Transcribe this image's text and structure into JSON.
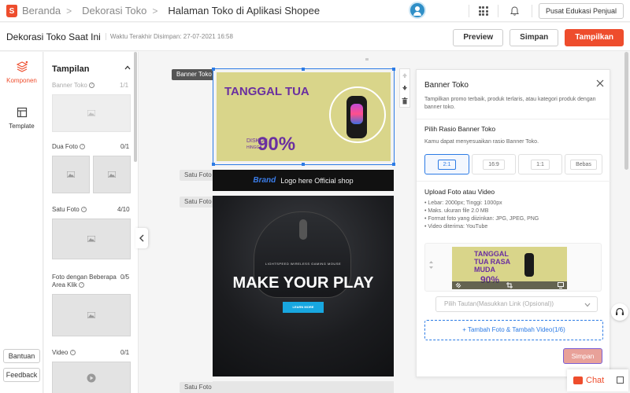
{
  "nav": {
    "breadcrumbs": [
      "Beranda",
      "Dekorasi Toko",
      "Halaman Toko di Aplikasi Shopee"
    ],
    "edu_button": "Pusat Edukasi Penjual"
  },
  "header": {
    "title": "Dekorasi Toko Saat Ini",
    "saved": "Waktu Terakhir Disimpan: 27-07-2021 16:58",
    "preview": "Preview",
    "save": "Simpan",
    "publish": "Tampilkan"
  },
  "leftbar": {
    "komponen": "Komponen",
    "template": "Template",
    "bantuan": "Bantuan",
    "feedback": "Feedback"
  },
  "panel": {
    "title": "Tampilan",
    "components": [
      {
        "label": "Banner Toko",
        "count": "1/1"
      },
      {
        "label": "Dua Foto",
        "count": "0/1"
      },
      {
        "label": "Satu Foto",
        "count": "4/10"
      },
      {
        "label": "Foto dengan Beberapa Area Klik",
        "count": "0/5"
      },
      {
        "label": "Video",
        "count": "0/1"
      }
    ]
  },
  "canvas": {
    "banner_label": "Banner Toko",
    "satu_foto": "Satu Foto",
    "banner_headline": "TANGGAL TUA",
    "banner_diskon": "DISKON",
    "banner_hingga": "HINGGA",
    "banner_pct": "90%",
    "brand": "Brand",
    "brand_text": "Logo here Official shop",
    "mouse_small": "LIGHTSPEED WIRELESS GAMING MOUSE",
    "mouse_big": "MAKE YOUR PLAY",
    "learn_more": "LEARN MORE"
  },
  "settings": {
    "title": "Banner Toko",
    "desc": "Tampilkan promo terbaik, produk terlaris, atau kategori produk dengan banner toko.",
    "ratio_title": "Pilih Rasio Banner Toko",
    "ratio_desc": "Kamu dapat menyesuaikan rasio Banner Toko.",
    "ratios": [
      "2:1",
      "16:9",
      "1:1",
      "Bebas"
    ],
    "upload_title": "Upload Foto atau Video",
    "bullets": [
      "Lebar: 2000px; Tinggi: 1000px",
      "Maks. ukuran file 2.0 MB",
      "Format foto yang diizinkan: JPG, JPEG, PNG",
      "Video diterima: YouTube"
    ],
    "thumb_headline": "TANGGAL TUA RASA MUDA",
    "thumb_pct": "90%",
    "link_placeholder": "Pilih Tautan(Masukkan Link (Opsional))",
    "add_media": "Tambah Foto & Tambah Video(1/6)",
    "save": "Simpan"
  },
  "chat": {
    "label": "Chat"
  },
  "colors": {
    "brand": "#ee4d2d",
    "accent": "#2c7be5",
    "banner_bg": "#d9d58a"
  }
}
